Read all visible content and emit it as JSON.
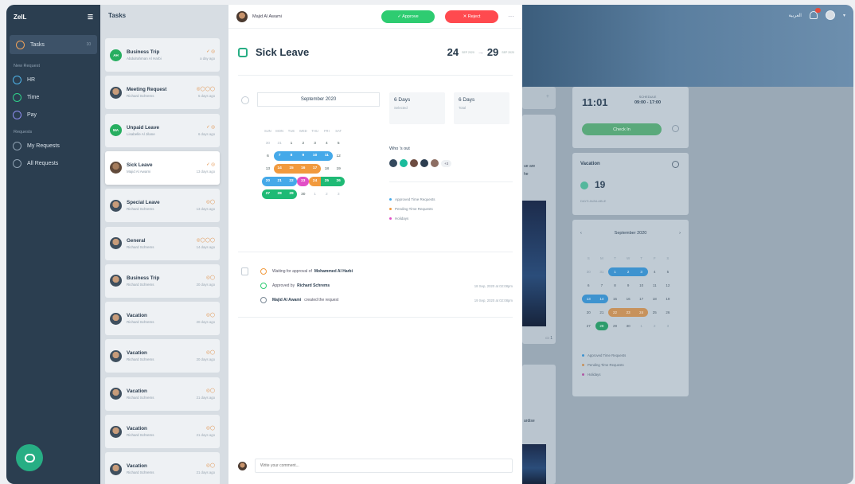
{
  "sidebar": {
    "brand": "ZeIL",
    "items": [
      {
        "label": "Tasks",
        "badge": "10",
        "color": "#f0a25a",
        "active": true
      },
      {
        "group": "New Request"
      },
      {
        "label": "HR",
        "color": "#4fb3e8"
      },
      {
        "label": "Time",
        "color": "#2fcf8a"
      },
      {
        "label": "Pay",
        "color": "#8e8df0"
      },
      {
        "group": "Requests"
      },
      {
        "label": "My Requests",
        "color": "#8ea0b1"
      },
      {
        "label": "All Requests",
        "color": "#8ea0b1"
      }
    ]
  },
  "tasks": {
    "title": "Tasks",
    "items": [
      {
        "title": "Business Trip",
        "sub": "Abdulrahman Al Harbi",
        "icons": "✓ ◎",
        "time": "a day ago",
        "avatar": "green",
        "initials": "AH"
      },
      {
        "title": "Meeting Request",
        "sub": "Richard Schrems",
        "icons": "◎◯◯◯",
        "time": "5 days ago",
        "avatar": "photo"
      },
      {
        "title": "Unpaid Leave",
        "sub": "Lisabelle Al Jilane",
        "icons": "✓ ◎",
        "time": "6 days ago",
        "avatar": "green",
        "initials": "MA"
      },
      {
        "title": "Sick Leave",
        "sub": "Majid Al Awami",
        "icons": "✓ ◎",
        "time": "13 days ago",
        "avatar": "brown"
      },
      {
        "title": "Special Leave",
        "sub": "Richard Schrems",
        "icons": "◎◯",
        "time": "13 days ago",
        "avatar": "photo"
      },
      {
        "title": "General",
        "sub": "Richard Schrems",
        "icons": "◎◯◯◯",
        "time": "14 days ago",
        "avatar": "photo"
      },
      {
        "title": "Business Trip",
        "sub": "Richard Schrems",
        "icons": "◎◯",
        "time": "20 days ago",
        "avatar": "photo"
      },
      {
        "title": "Vacation",
        "sub": "Richard Schrems",
        "icons": "◎◯",
        "time": "20 days ago",
        "avatar": "photo"
      },
      {
        "title": "Vacation",
        "sub": "Richard Schrems",
        "icons": "◎◯",
        "time": "20 days ago",
        "avatar": "photo"
      },
      {
        "title": "Vacation",
        "sub": "Richard Schrems",
        "icons": "◎◯",
        "time": "21 days ago",
        "avatar": "photo"
      },
      {
        "title": "Vacation",
        "sub": "Richard Schrems",
        "icons": "◎◯",
        "time": "21 days ago",
        "avatar": "photo"
      },
      {
        "title": "Vacation",
        "sub": "Richard Schrems",
        "icons": "◎◯",
        "time": "21 days ago",
        "avatar": "photo"
      }
    ]
  },
  "detail": {
    "requester": "Majid Al Awami",
    "approve": "✓ Approve",
    "reject": "✕ Reject",
    "title": "Sick Leave",
    "from_day": "24",
    "from_month": "SEP 2020",
    "to_day": "29",
    "to_month": "SEP 2020",
    "calendar_month": "September 2020",
    "days_selected": "6 Days",
    "days_selected_label": "Selected",
    "days_total": "6 Days",
    "days_total_label": "Total",
    "whos_out": "Who 's out",
    "whos_out_more": "+3",
    "legend": [
      {
        "label": "Approved Time Requests",
        "color": "#45a9e9"
      },
      {
        "label": "Pending Time Requests",
        "color": "#f19a3e"
      },
      {
        "label": "Holidays",
        "color": "#e24fc6"
      }
    ],
    "history": [
      {
        "pre": "Waiting for approval of",
        "name": "Mohammed Al Harbi",
        "when": "",
        "color": "#f19a3e"
      },
      {
        "pre": "Approved by",
        "name": "Richard Schrems",
        "when": "18 Sep, 2020 at 02:08pm",
        "color": "#2ecc71"
      },
      {
        "pre": "",
        "name": "Majid Al Awami",
        "post": "created the request",
        "when": "19 Sep, 2020 at 02:08pm",
        "color": "#7a8895"
      }
    ],
    "comment_placeholder": "Write your comment..."
  },
  "calendar": {
    "dow": [
      "SUN",
      "MON",
      "TUE",
      "WED",
      "THU",
      "FRI",
      "SAT"
    ],
    "weeks": [
      [
        [
          "30",
          "dim"
        ],
        [
          "31",
          "dim"
        ],
        [
          "1",
          ""
        ],
        [
          "2",
          ""
        ],
        [
          "3",
          ""
        ],
        [
          "4",
          ""
        ],
        [
          "5",
          ""
        ]
      ],
      [
        [
          "6",
          ""
        ],
        [
          "7",
          "blue first"
        ],
        [
          "8",
          "blue"
        ],
        [
          "9",
          "blue"
        ],
        [
          "10",
          "blue"
        ],
        [
          "11",
          "blue last"
        ],
        [
          "12",
          ""
        ]
      ],
      [
        [
          "13",
          ""
        ],
        [
          "14",
          "orange first"
        ],
        [
          "15",
          "orange"
        ],
        [
          "16",
          "orange"
        ],
        [
          "17",
          "orange last"
        ],
        [
          "18",
          ""
        ],
        [
          "19",
          ""
        ]
      ],
      [
        [
          "20",
          "blue first"
        ],
        [
          "21",
          "blue"
        ],
        [
          "22",
          "blue last"
        ],
        [
          "23",
          "pink one"
        ],
        [
          "24",
          "orange first"
        ],
        [
          "25",
          "green"
        ],
        [
          "26",
          "green last"
        ]
      ],
      [
        [
          "27",
          "green first"
        ],
        [
          "28",
          "green"
        ],
        [
          "29",
          "green last"
        ],
        [
          "30",
          ""
        ],
        [
          "1",
          "dim"
        ],
        [
          "2",
          "dim"
        ],
        [
          "3",
          "dim"
        ]
      ]
    ]
  },
  "dashboard": {
    "lang": "العربية",
    "notif_count": "9+",
    "clock_time": "11:01",
    "schedule_label": "SCHEDULE",
    "schedule": "09:00 - 17:00",
    "checkin": "Check In",
    "vacation_title": "Vacation",
    "vacation_days": "19",
    "vacation_label": "DAYS AVAILABLE",
    "mini_month": "September 2020",
    "mini_dow": [
      "S",
      "M",
      "T",
      "W",
      "T",
      "F",
      "S"
    ],
    "mini_weeks": [
      [
        [
          "30",
          "dim"
        ],
        [
          "31",
          "dim"
        ],
        [
          "1",
          "blue first"
        ],
        [
          "2",
          "blue"
        ],
        [
          "3",
          "blue last"
        ],
        [
          "4",
          ""
        ],
        [
          "5",
          ""
        ]
      ],
      [
        [
          "6",
          ""
        ],
        [
          "7",
          ""
        ],
        [
          "8",
          ""
        ],
        [
          "9",
          ""
        ],
        [
          "10",
          ""
        ],
        [
          "11",
          ""
        ],
        [
          "12",
          ""
        ]
      ],
      [
        [
          "13",
          "blue first"
        ],
        [
          "14",
          "blue last"
        ],
        [
          "15",
          ""
        ],
        [
          "16",
          ""
        ],
        [
          "17",
          ""
        ],
        [
          "18",
          ""
        ],
        [
          "19",
          ""
        ]
      ],
      [
        [
          "20",
          ""
        ],
        [
          "21",
          ""
        ],
        [
          "22",
          "org first"
        ],
        [
          "23",
          "org"
        ],
        [
          "24",
          "org last"
        ],
        [
          "25",
          ""
        ],
        [
          "26",
          ""
        ]
      ],
      [
        [
          "27",
          ""
        ],
        [
          "28",
          "grn"
        ],
        [
          "29",
          ""
        ],
        [
          "30",
          ""
        ],
        [
          "1",
          "dim"
        ],
        [
          "2",
          "dim"
        ],
        [
          "3",
          "dim"
        ]
      ]
    ],
    "mini_legend": [
      {
        "label": "Approved Time Requests",
        "color": "#3e93cf"
      },
      {
        "label": "Pending Time Requests",
        "color": "#c7925c"
      },
      {
        "label": "Holidays",
        "color": "#b05aa5"
      }
    ],
    "peek_text_1": "ue are",
    "peek_text_2": "he",
    "peek_text_3": "ardise",
    "peek_count": "1"
  }
}
